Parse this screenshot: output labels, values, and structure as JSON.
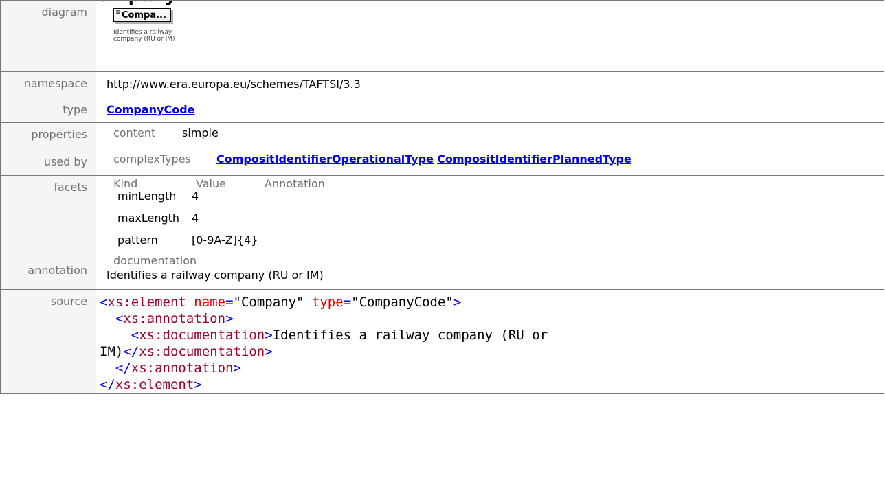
{
  "title": "Company",
  "rows": {
    "diagram": {
      "label": "diagram",
      "box_text": "Compa...",
      "caption": "Identifies a railway company (RU or IM)",
      "icon": "element-lines-icon"
    },
    "namespace": {
      "label": "namespace",
      "value": "http://www.era.europa.eu/schemes/TAFTSI/3.3"
    },
    "type": {
      "label": "type",
      "value": "CompanyCode"
    },
    "properties": {
      "label": "properties",
      "key": "content",
      "value": "simple"
    },
    "used_by": {
      "label": "used by",
      "key": "complexTypes",
      "links": [
        "CompositIdentifierOperationalType",
        "CompositIdentifierPlannedType"
      ]
    },
    "facets": {
      "label": "facets",
      "headers": [
        "Kind",
        "Value",
        "Annotation"
      ],
      "items": [
        {
          "kind": "minLength",
          "value": "4"
        },
        {
          "kind": "maxLength",
          "value": "4"
        },
        {
          "kind": "pattern",
          "value": "[0-9A-Z]{4}"
        }
      ]
    },
    "annotation": {
      "label": "annotation",
      "key": "documentation",
      "value": "Identifies a railway company (RU or IM)"
    },
    "source": {
      "label": "source",
      "lines": [
        "<xs:element name=\"Company\" type=\"CompanyCode\">",
        "  <xs:annotation>",
        "    <xs:documentation>Identifies a railway company (RU or",
        "IM)</xs:documentation>",
        "  </xs:annotation>",
        "</xs:element>"
      ]
    }
  },
  "colors": {
    "link": "#0000ee",
    "tag": "#a0002a",
    "attr_name": "#ee0000",
    "label": "#707070"
  }
}
